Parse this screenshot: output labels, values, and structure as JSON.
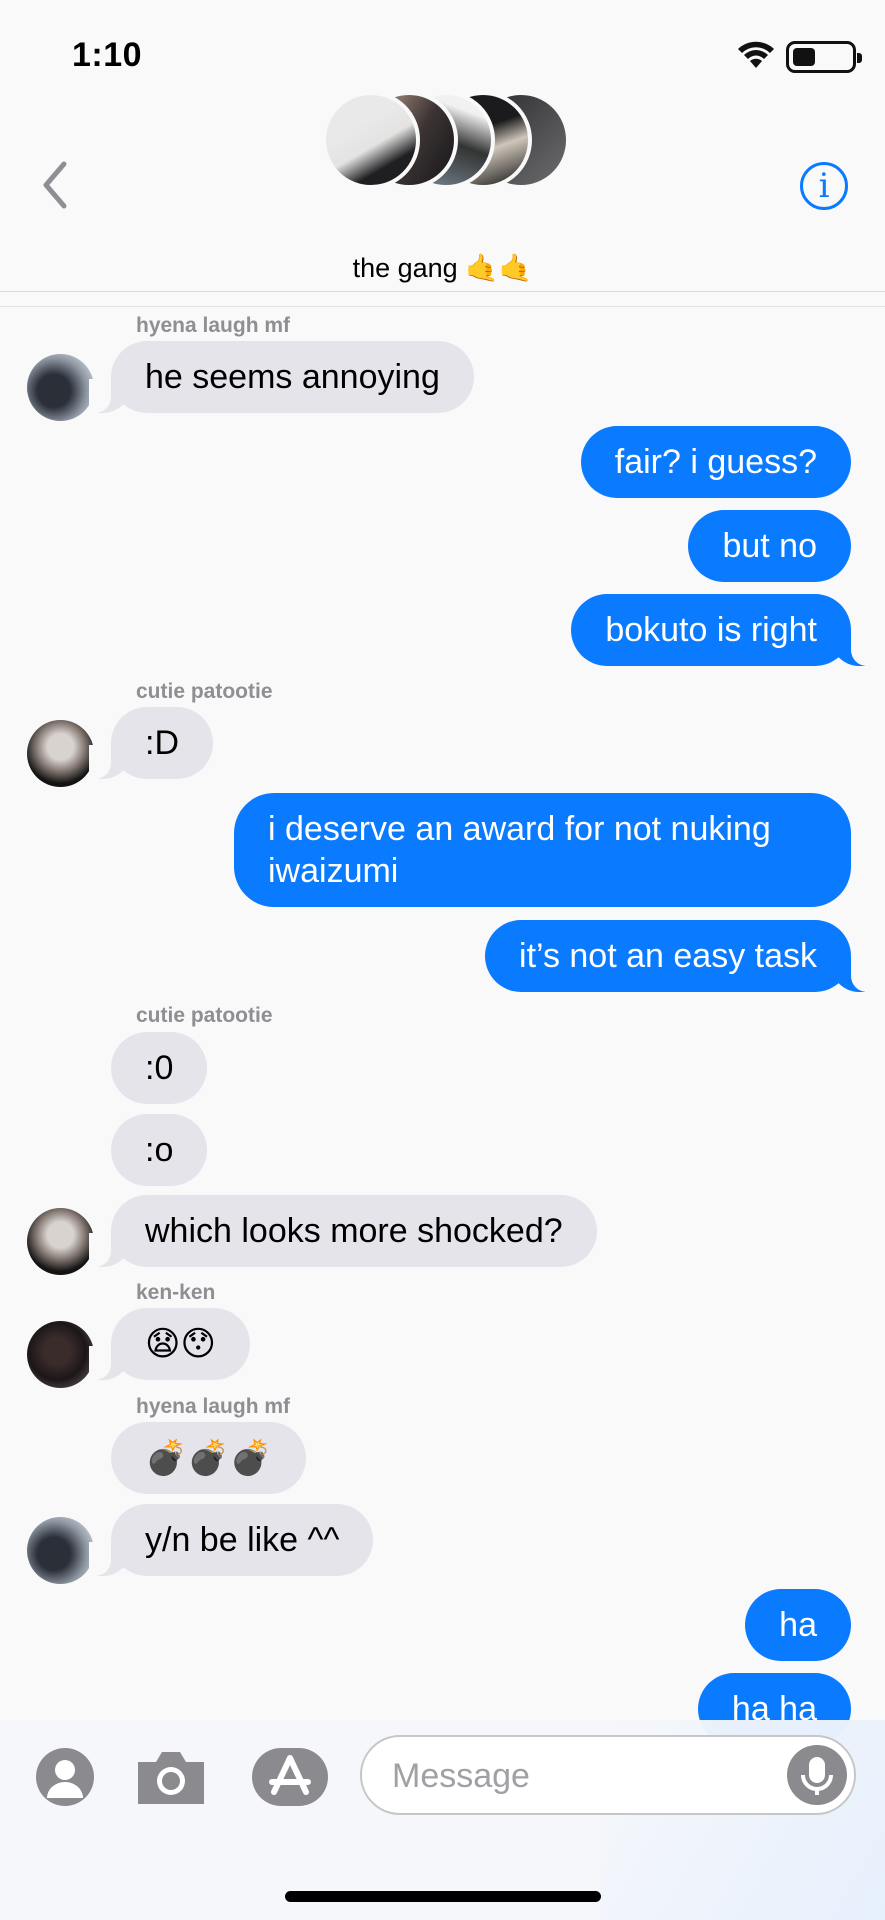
{
  "status_bar": {
    "time": "1:10",
    "icons": [
      "wifi-icon",
      "battery-icon"
    ]
  },
  "header": {
    "group_name": "the gang 🤙🤙",
    "icons": [
      "back-chevron-icon",
      "info-icon"
    ],
    "group_avatars": 5
  },
  "messages": [
    {
      "id": 1,
      "dir": "in",
      "sender": "hyena laugh mf",
      "text": "he seems annoying"
    },
    {
      "id": 2,
      "dir": "out",
      "text": "fair? i guess?"
    },
    {
      "id": 3,
      "dir": "out",
      "text": "but no"
    },
    {
      "id": 4,
      "dir": "out",
      "text": "bokuto is right"
    },
    {
      "id": 5,
      "dir": "in",
      "sender": "cutie patootie",
      "text": ":D"
    },
    {
      "id": 6,
      "dir": "out",
      "text": "i deserve an award for not nuking iwaizumi"
    },
    {
      "id": 7,
      "dir": "out",
      "text": "it’s not an easy task"
    },
    {
      "id": 8,
      "dir": "in",
      "sender": "cutie patootie",
      "text": ":0"
    },
    {
      "id": 9,
      "dir": "in",
      "text": ":o"
    },
    {
      "id": 10,
      "dir": "in",
      "text": "which looks more shocked?"
    },
    {
      "id": 11,
      "dir": "in",
      "sender": "ken-ken",
      "text": "😧😯"
    },
    {
      "id": 12,
      "dir": "in",
      "sender": "hyena laugh mf",
      "text": "💣💣💣"
    },
    {
      "id": 13,
      "dir": "in",
      "text": "y/n be like ^^"
    },
    {
      "id": 14,
      "dir": "out",
      "text": "ha"
    },
    {
      "id": 15,
      "dir": "out",
      "text": "ha ha"
    }
  ],
  "compose": {
    "placeholder": "Message",
    "icons": [
      "contact-icon",
      "camera-icon",
      "app-store-icon",
      "microphone-icon"
    ]
  },
  "colors": {
    "sent": "#0a7bff",
    "received": "#e5e4ea",
    "accent": "#0a7bff"
  }
}
